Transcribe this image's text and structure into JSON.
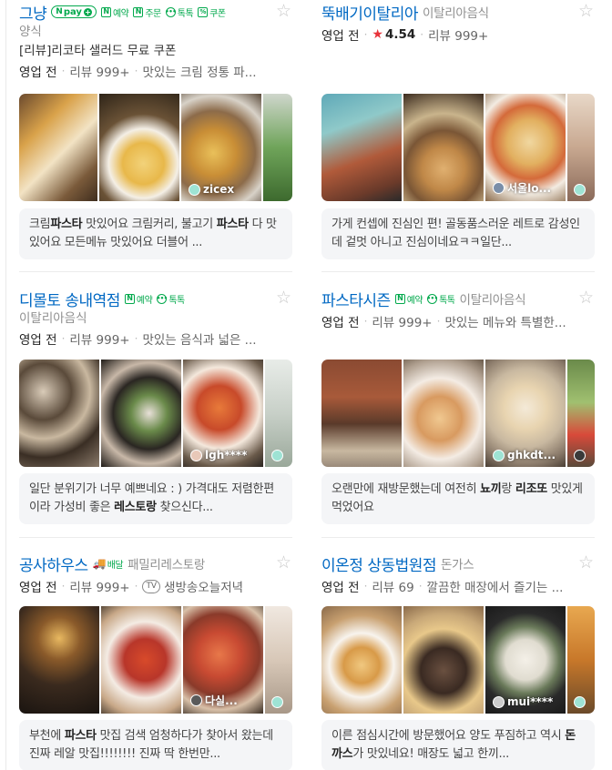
{
  "cards": [
    {
      "title": "그냥",
      "badges": [
        {
          "type": "npay",
          "label": "pay"
        },
        {
          "type": "n",
          "label": "예약"
        },
        {
          "type": "n",
          "label": "주문"
        },
        {
          "type": "talk",
          "label": "톡톡"
        },
        {
          "type": "coupon",
          "label": "쿠폰"
        }
      ],
      "category": "",
      "subcategory": "양식",
      "coupon_text": "[리뷰]리코타 샐러드 무료 쿠폰",
      "meta": {
        "open": "영업 전",
        "review": "리뷰 999+",
        "extra": "맛있는 크림 정통 파..."
      },
      "photo_author": "zicex",
      "review_parts": [
        "크림",
        "파스타",
        " 맛있어요 크림커리, 불고기 ",
        "파스타",
        " 다 맛있어요 모든메뉴 맛있어요 더블어 ..."
      ]
    },
    {
      "title": "뚝배기이탈리아",
      "category": "이탈리아음식",
      "meta": {
        "open": "영업 전",
        "rating": "4.54",
        "review": "리뷰 999+"
      },
      "photo_author": "서울lo...",
      "review_parts": [
        "가게 컨셉에 진심인 편! 골동품스러운 레트로 감성인데 겉멋 아니고 진심이네요ㅋㅋ일단..."
      ]
    },
    {
      "title": "디몰토 송내역점",
      "badges": [
        {
          "type": "n",
          "label": "예약"
        },
        {
          "type": "talk",
          "label": "톡톡"
        }
      ],
      "subcategory": "이탈리아음식",
      "meta": {
        "open": "영업 전",
        "review": "리뷰 999+",
        "extra": "맛있는 음식과 넓은 ..."
      },
      "photo_author": "lgh****",
      "review_parts": [
        "일단 분위기가 너무 예쁘네요 : ) 가격대도 저렴한편이라 가성비 좋은 ",
        "레스토랑",
        " 찾으신다..."
      ]
    },
    {
      "title": "파스타시즌",
      "badges": [
        {
          "type": "n",
          "label": "예약"
        },
        {
          "type": "talk",
          "label": "톡톡"
        }
      ],
      "category": "이탈리아음식",
      "meta": {
        "open": "영업 전",
        "review": "리뷰 999+",
        "extra": "맛있는 메뉴와 특별한..."
      },
      "photo_author": "ghkdt...",
      "review_parts": [
        "오랜만에 재방문했는데 여전히 ",
        "뇨끼",
        "랑 ",
        "리조또",
        " 맛있게 먹었어요"
      ]
    },
    {
      "title": "공사하우스",
      "badges": [
        {
          "type": "delivery",
          "label": "배달"
        }
      ],
      "category": "패밀리레스토랑",
      "meta": {
        "open": "영업 전",
        "review": "리뷰 999+",
        "tv": "TV",
        "extra": "생방송오늘저녁"
      },
      "photo_author": "다실...",
      "review_parts": [
        "부천에 ",
        "파스타",
        " 맛집 검색 엄청하다가 찾아서 왔는데진짜 레알 맛집!!!!!!!! 진짜 딱 한번만..."
      ]
    },
    {
      "title": "이온정 상동법원점",
      "category": "돈가스",
      "meta": {
        "open": "영업 전",
        "review": "리뷰 69",
        "extra": "깔끔한 매장에서 즐기는 ..."
      },
      "photo_author": "mui****",
      "review_parts": [
        "이른 점심시간에 방문했어요 양도 푸짐하고 역시 ",
        "돈까스",
        "가 맛있네요! 매장도 넓고 한끼..."
      ]
    }
  ],
  "colors": {
    "title": "#0068c3",
    "green": "#03a94d",
    "star": "#e8333a"
  }
}
